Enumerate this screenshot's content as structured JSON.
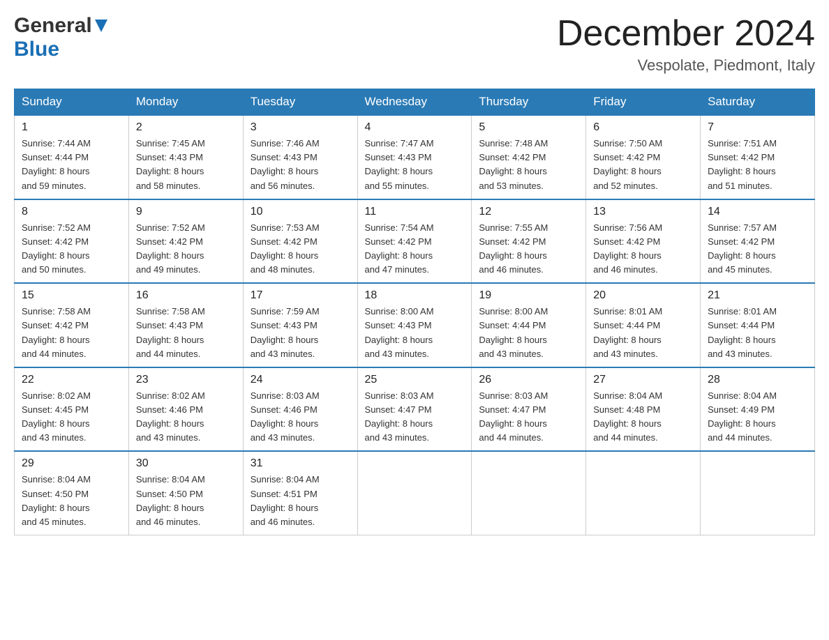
{
  "header": {
    "logo": {
      "general": "General",
      "blue": "Blue"
    },
    "title": "December 2024",
    "location": "Vespolate, Piedmont, Italy"
  },
  "calendar": {
    "days_of_week": [
      "Sunday",
      "Monday",
      "Tuesday",
      "Wednesday",
      "Thursday",
      "Friday",
      "Saturday"
    ],
    "weeks": [
      [
        {
          "day": "1",
          "sunrise": "7:44 AM",
          "sunset": "4:44 PM",
          "daylight": "8 hours and 59 minutes."
        },
        {
          "day": "2",
          "sunrise": "7:45 AM",
          "sunset": "4:43 PM",
          "daylight": "8 hours and 58 minutes."
        },
        {
          "day": "3",
          "sunrise": "7:46 AM",
          "sunset": "4:43 PM",
          "daylight": "8 hours and 56 minutes."
        },
        {
          "day": "4",
          "sunrise": "7:47 AM",
          "sunset": "4:43 PM",
          "daylight": "8 hours and 55 minutes."
        },
        {
          "day": "5",
          "sunrise": "7:48 AM",
          "sunset": "4:42 PM",
          "daylight": "8 hours and 53 minutes."
        },
        {
          "day": "6",
          "sunrise": "7:50 AM",
          "sunset": "4:42 PM",
          "daylight": "8 hours and 52 minutes."
        },
        {
          "day": "7",
          "sunrise": "7:51 AM",
          "sunset": "4:42 PM",
          "daylight": "8 hours and 51 minutes."
        }
      ],
      [
        {
          "day": "8",
          "sunrise": "7:52 AM",
          "sunset": "4:42 PM",
          "daylight": "8 hours and 50 minutes."
        },
        {
          "day": "9",
          "sunrise": "7:52 AM",
          "sunset": "4:42 PM",
          "daylight": "8 hours and 49 minutes."
        },
        {
          "day": "10",
          "sunrise": "7:53 AM",
          "sunset": "4:42 PM",
          "daylight": "8 hours and 48 minutes."
        },
        {
          "day": "11",
          "sunrise": "7:54 AM",
          "sunset": "4:42 PM",
          "daylight": "8 hours and 47 minutes."
        },
        {
          "day": "12",
          "sunrise": "7:55 AM",
          "sunset": "4:42 PM",
          "daylight": "8 hours and 46 minutes."
        },
        {
          "day": "13",
          "sunrise": "7:56 AM",
          "sunset": "4:42 PM",
          "daylight": "8 hours and 46 minutes."
        },
        {
          "day": "14",
          "sunrise": "7:57 AM",
          "sunset": "4:42 PM",
          "daylight": "8 hours and 45 minutes."
        }
      ],
      [
        {
          "day": "15",
          "sunrise": "7:58 AM",
          "sunset": "4:42 PM",
          "daylight": "8 hours and 44 minutes."
        },
        {
          "day": "16",
          "sunrise": "7:58 AM",
          "sunset": "4:43 PM",
          "daylight": "8 hours and 44 minutes."
        },
        {
          "day": "17",
          "sunrise": "7:59 AM",
          "sunset": "4:43 PM",
          "daylight": "8 hours and 43 minutes."
        },
        {
          "day": "18",
          "sunrise": "8:00 AM",
          "sunset": "4:43 PM",
          "daylight": "8 hours and 43 minutes."
        },
        {
          "day": "19",
          "sunrise": "8:00 AM",
          "sunset": "4:44 PM",
          "daylight": "8 hours and 43 minutes."
        },
        {
          "day": "20",
          "sunrise": "8:01 AM",
          "sunset": "4:44 PM",
          "daylight": "8 hours and 43 minutes."
        },
        {
          "day": "21",
          "sunrise": "8:01 AM",
          "sunset": "4:44 PM",
          "daylight": "8 hours and 43 minutes."
        }
      ],
      [
        {
          "day": "22",
          "sunrise": "8:02 AM",
          "sunset": "4:45 PM",
          "daylight": "8 hours and 43 minutes."
        },
        {
          "day": "23",
          "sunrise": "8:02 AM",
          "sunset": "4:46 PM",
          "daylight": "8 hours and 43 minutes."
        },
        {
          "day": "24",
          "sunrise": "8:03 AM",
          "sunset": "4:46 PM",
          "daylight": "8 hours and 43 minutes."
        },
        {
          "day": "25",
          "sunrise": "8:03 AM",
          "sunset": "4:47 PM",
          "daylight": "8 hours and 43 minutes."
        },
        {
          "day": "26",
          "sunrise": "8:03 AM",
          "sunset": "4:47 PM",
          "daylight": "8 hours and 44 minutes."
        },
        {
          "day": "27",
          "sunrise": "8:04 AM",
          "sunset": "4:48 PM",
          "daylight": "8 hours and 44 minutes."
        },
        {
          "day": "28",
          "sunrise": "8:04 AM",
          "sunset": "4:49 PM",
          "daylight": "8 hours and 44 minutes."
        }
      ],
      [
        {
          "day": "29",
          "sunrise": "8:04 AM",
          "sunset": "4:50 PM",
          "daylight": "8 hours and 45 minutes."
        },
        {
          "day": "30",
          "sunrise": "8:04 AM",
          "sunset": "4:50 PM",
          "daylight": "8 hours and 46 minutes."
        },
        {
          "day": "31",
          "sunrise": "8:04 AM",
          "sunset": "4:51 PM",
          "daylight": "8 hours and 46 minutes."
        },
        null,
        null,
        null,
        null
      ]
    ],
    "labels": {
      "sunrise": "Sunrise:",
      "sunset": "Sunset:",
      "daylight": "Daylight:"
    }
  }
}
